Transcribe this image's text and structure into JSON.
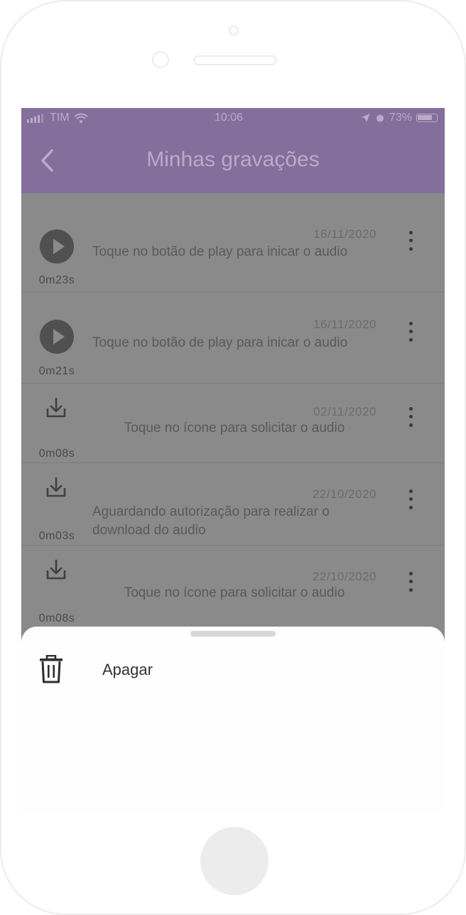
{
  "status_bar": {
    "carrier": "TIM",
    "time": "10:06",
    "battery": "73%"
  },
  "app_bar": {
    "title": "Minhas gravações",
    "back_icon": "chevron-left-icon"
  },
  "recordings": [
    {
      "date": "16/11/2020",
      "description": "Toque no botão de play para inicar o audio",
      "duration": "0m23s",
      "icon": "play-icon",
      "align": "left"
    },
    {
      "date": "16/11/2020",
      "description": "Toque no botão de play para inicar o audio",
      "duration": "0m21s",
      "icon": "play-icon",
      "align": "left"
    },
    {
      "date": "02/11/2020",
      "description": "Toque no ícone para solicitar o audio",
      "duration": "0m08s",
      "icon": "download-icon",
      "align": "center"
    },
    {
      "date": "22/10/2020",
      "description": "Aguardando autorização para realizar o download do audio",
      "duration": "0m03s",
      "icon": "download-icon",
      "align": "left"
    },
    {
      "date": "22/10/2020",
      "description": "Toque no ícone para solicitar o audio",
      "duration": "0m08s",
      "icon": "download-icon",
      "align": "center"
    }
  ],
  "bottom_sheet": {
    "items": [
      {
        "label": "Apagar",
        "icon": "trash-icon"
      }
    ]
  },
  "colors": {
    "accent": "#836e9c",
    "overlay": "#8a8a8a",
    "sheet": "#fefefe"
  }
}
